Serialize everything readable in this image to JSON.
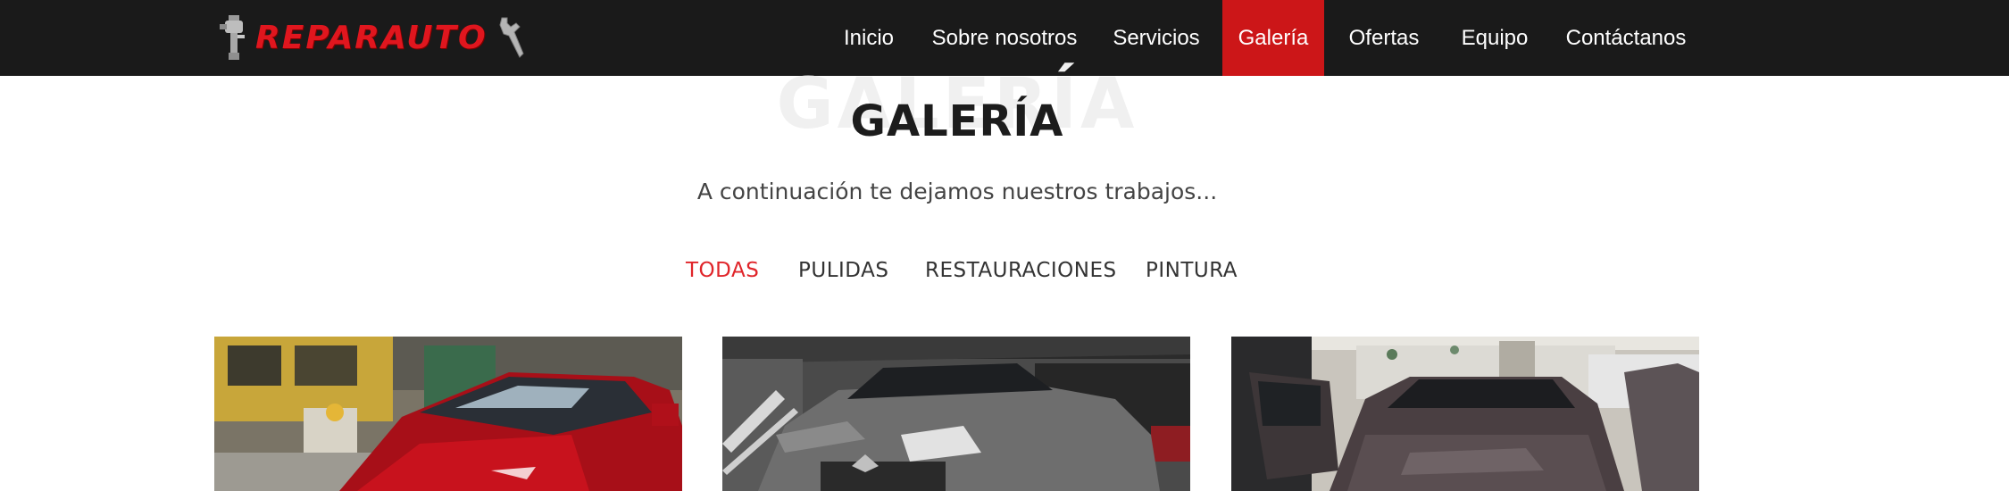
{
  "brand": {
    "name": "REPARAUTO"
  },
  "nav": {
    "items": [
      {
        "label": "Inicio"
      },
      {
        "label": "Sobre nosotros"
      },
      {
        "label": "Servicios"
      },
      {
        "label": "Galería",
        "active": true
      },
      {
        "label": "Ofertas"
      },
      {
        "label": "Equipo"
      },
      {
        "label": "Contáctanos"
      }
    ]
  },
  "section": {
    "watermark": "GALERÍA",
    "title": "GALERÍA",
    "subtitle": "A continuación te dejamos nuestros trabajos..."
  },
  "filters": [
    {
      "label": "TODAS",
      "active": true
    },
    {
      "label": "PULIDAS"
    },
    {
      "label": "RESTAURACIONES"
    },
    {
      "label": "PINTURA"
    }
  ],
  "gallery": {
    "items": [
      {
        "subject": "red-car-in-workshop"
      },
      {
        "subject": "grey-sedan-in-garage"
      },
      {
        "subject": "dark-car-with-doors-open"
      }
    ]
  },
  "colors": {
    "navbar_bg": "#1a1a1a",
    "accent": "#cc1618",
    "brand_red": "#e0161e",
    "text_dark": "#1c1c1c"
  }
}
